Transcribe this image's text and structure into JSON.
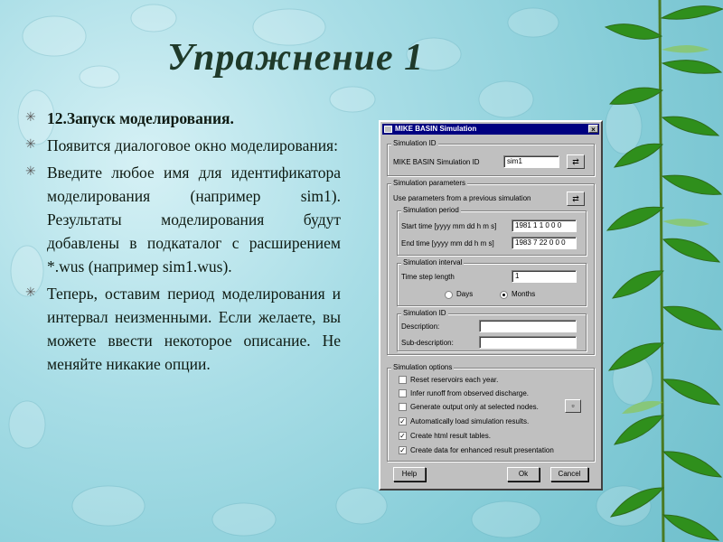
{
  "slide": {
    "title": "Упражнение 1",
    "bullets": [
      {
        "text": "12.Запуск моделирования.",
        "bold": true
      },
      {
        "text": "Появится диалоговое окно моделирования:",
        "bold": false
      },
      {
        "text": "Введите любое имя для идентификатора моделирования (например sim1). Результаты моделирования будут добавлены в подкаталог с расширением *.wus (например sim1.wus).",
        "bold": false
      },
      {
        "text": "Теперь, оставим период моделирования и интервал неизменными. Если желаете, вы можете ввести некоторое описание. Не меняйте никакие опции.",
        "bold": false
      }
    ],
    "bullet_glyph": "✳"
  },
  "dialog": {
    "title": "MIKE BASIN Simulation",
    "close_glyph": "×",
    "simulation_id_group": {
      "legend": "Simulation ID",
      "label": "MIKE BASIN Simulation ID",
      "value": "sim1"
    },
    "params_group": {
      "legend": "Simulation parameters",
      "use_prev_label": "Use parameters from a previous simulation",
      "period": {
        "legend": "Simulation period",
        "start_label": "Start time [yyyy mm dd h m s]",
        "start_value": "1981 1 1 0 0 0",
        "end_label": "End time [yyyy mm dd h m s]",
        "end_value": "1983 7 22 0 0 0"
      },
      "interval": {
        "legend": "Simulation interval",
        "step_label": "Time step length",
        "step_value": "1",
        "days_label": "Days",
        "months_label": "Months",
        "selected": "months"
      },
      "sim_id": {
        "legend": "Simulation ID",
        "desc_label": "Description:",
        "desc_value": "",
        "subdesc_label": "Sub-description:",
        "subdesc_value": ""
      }
    },
    "options_group": {
      "legend": "Simulation options",
      "options": [
        {
          "label": "Reset reservoirs each year.",
          "checked": false
        },
        {
          "label": "Infer runoff from observed discharge.",
          "checked": false
        },
        {
          "label": "Generate output only at selected nodes.",
          "checked": false
        },
        {
          "label": "Automatically load simulation results.",
          "checked": true
        },
        {
          "label": "Create html result tables.",
          "checked": true
        },
        {
          "label": "Create data for enhanced result presentation",
          "checked": true
        }
      ]
    },
    "buttons": {
      "help": "Help",
      "ok": "Ok",
      "cancel": "Cancel"
    }
  }
}
